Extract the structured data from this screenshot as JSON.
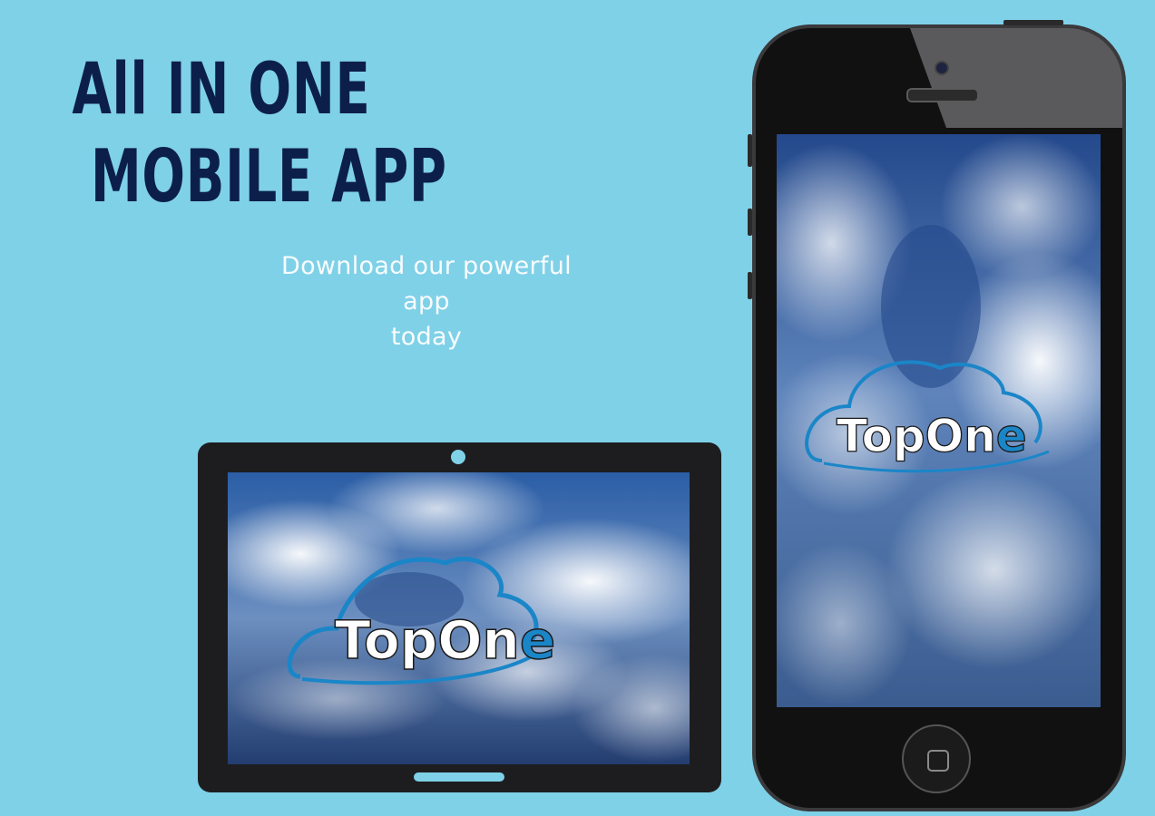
{
  "headline": {
    "line1": "All IN ONE",
    "line2": "MOBILE APP"
  },
  "subtitle": {
    "line1": "Download our powerful app",
    "line2": "today"
  },
  "logo": {
    "text_main": "TopOn",
    "text_accent": "e",
    "icon": "cloud-logo-icon"
  },
  "colors": {
    "background": "#7fd1e8",
    "headline": "#0c1f4a",
    "logo_accent": "#1a86c8",
    "device_body": "#1d1d1f"
  }
}
